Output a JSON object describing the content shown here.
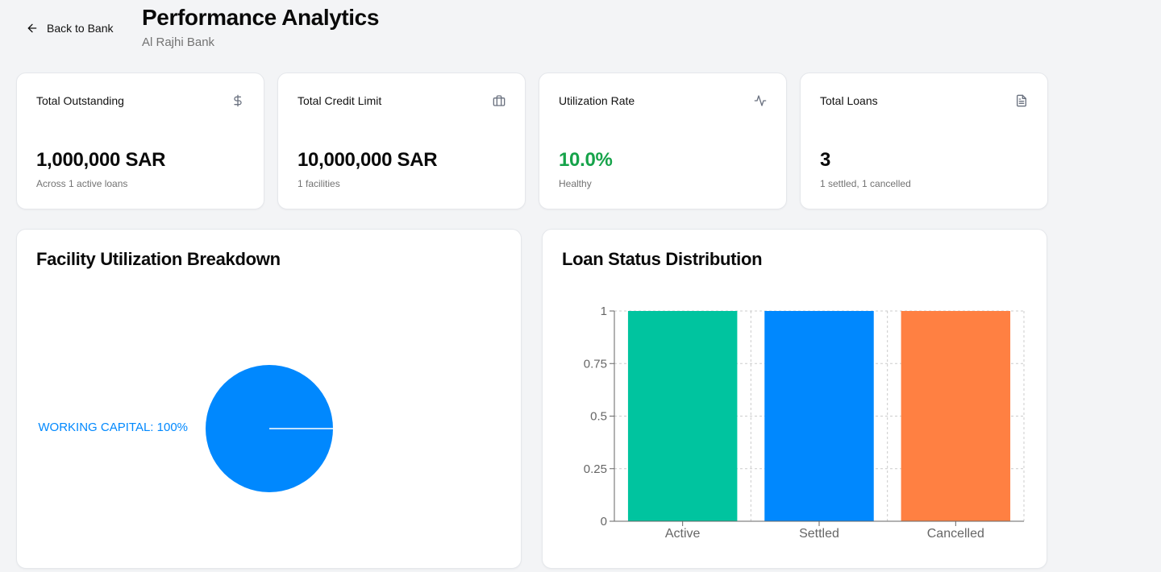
{
  "header": {
    "back_label": "Back to Bank",
    "title": "Performance Analytics",
    "subtitle": "Al Rajhi Bank"
  },
  "stats": [
    {
      "label": "Total Outstanding",
      "icon": "dollar-icon",
      "value": "1,000,000 SAR",
      "note": "Across 1 active loans"
    },
    {
      "label": "Total Credit Limit",
      "icon": "briefcase-icon",
      "value": "10,000,000 SAR",
      "note": "1 facilities"
    },
    {
      "label": "Utilization Rate",
      "icon": "activity-icon",
      "value": "10.0%",
      "note": "Healthy",
      "value_color": "#16a34a"
    },
    {
      "label": "Total Loans",
      "icon": "file-text-icon",
      "value": "3",
      "note": "1 settled, 1 cancelled"
    }
  ],
  "facility_panel": {
    "title": "Facility Utilization Breakdown"
  },
  "loan_panel": {
    "title": "Loan Status Distribution"
  },
  "chart_data": [
    {
      "type": "pie",
      "title": "Facility Utilization Breakdown",
      "slices": [
        {
          "label": "WORKING CAPITAL: 100%",
          "value": 100,
          "color": "#0088fe"
        }
      ]
    },
    {
      "type": "bar",
      "title": "Loan Status Distribution",
      "categories": [
        "Active",
        "Settled",
        "Cancelled"
      ],
      "values": [
        1,
        1,
        1
      ],
      "colors": [
        "#00c49f",
        "#0088fe",
        "#ff8042"
      ],
      "yticks": [
        "0",
        "0.25",
        "0.5",
        "0.75",
        "1"
      ],
      "ylim": [
        0,
        1
      ],
      "grid": true
    }
  ]
}
